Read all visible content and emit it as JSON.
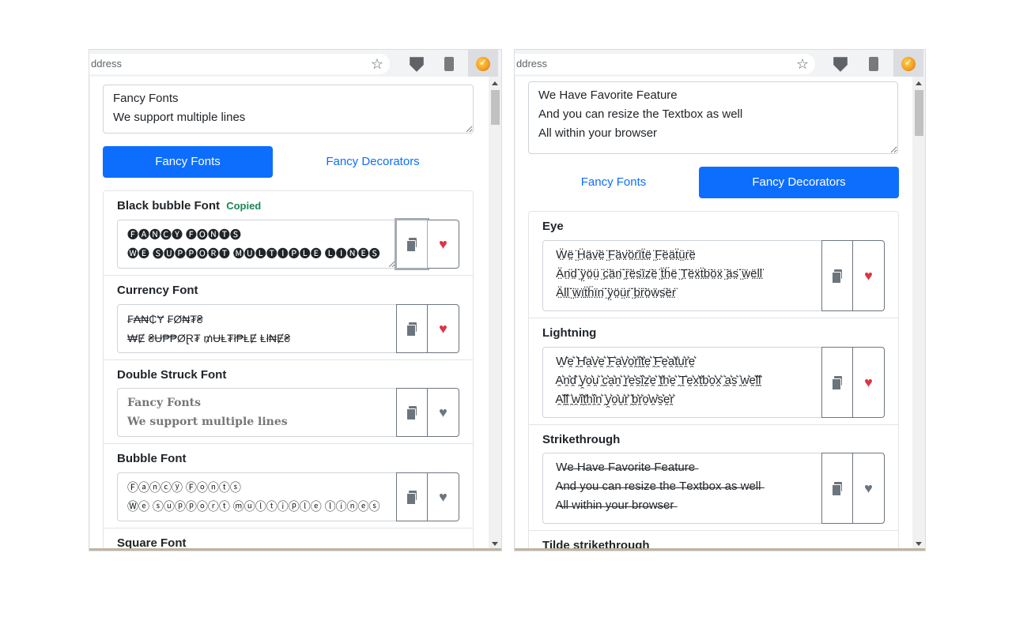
{
  "left": {
    "address_text": "ddress",
    "input_text": "Fancy Fonts\nWe support multiple lines",
    "tabs": [
      {
        "label": "Fancy Fonts",
        "active": true
      },
      {
        "label": "Fancy Decorators",
        "active": false
      }
    ],
    "items": [
      {
        "title": "Black bubble Font",
        "status": "Copied",
        "output": "🅕🅐🅝🅒🅨 🅕🅞🅝🅣🅢\n🅦🅔 🅢🅤🅟🅟🅞🅡🅣 🅜🅤🅛🅣🅘🅟🅛🅔 🅛🅘🅝🅔🅢",
        "favorite": true
      },
      {
        "title": "Currency Font",
        "output": "₣₳₦₵Ɏ ₣Ø₦₮₴\n₩Ɇ ₴Ʉ₱₱ØⱤ₮ ₥ɄⱠ₮ł₱ⱠɆ Ⱡł₦Ɇ₴",
        "favorite": true
      },
      {
        "title": "Double Struck Font",
        "output": "Fancy Fonts\nWe support multiple lines",
        "favorite": false
      },
      {
        "title": "Bubble Font",
        "output": "Ⓕⓐⓝⓒⓨ Ⓕⓞⓝⓣⓢ\nⓌⓔ ⓢⓤⓟⓟⓞⓡⓣ ⓜⓤⓛⓣⓘⓟⓛⓔ ⓛⓘⓝⓔⓢ",
        "favorite": false
      },
      {
        "title": "Square Font"
      }
    ]
  },
  "right": {
    "address_text": "ddress",
    "input_text": "We Have Favorite Feature\nAnd you can resize the Textbox as well\nAll within your browser",
    "tabs": [
      {
        "label": "Fancy Fonts",
        "active": false
      },
      {
        "label": "Fancy Decorators",
        "active": true
      }
    ],
    "items": [
      {
        "title": "Eye",
        "output": " Ẅ̤ë̤ ̤̈Ḧ̤ä̤v̤̈ë̤ ̤̈F̤̈ä̤v̤̈ö̤r̤̈ï̤ẗ̤ë̤ ̤̈F̤̈ë̤ä̤ẗ̤ṳ̈r̤̈ë̤\n Ä̤n̤̈d̤̈ ̤̈ÿ̤ö̤ṳ̈ ̤̈c̤̈ä̤n̤̈ ̤̈r̤̈ë̤s̤̈ï̤z̤̈ë̤ ̤̈ẗ̤ḧ̤ë̤ ̤̈T̤̈ë̤ẍ̤ẗ̤b̤̈ö̤ẍ̤ ̤̈ä̤s̤̈ ̤̈ẅ̤ë̤l̤̈l̤̈\n Ä̤l̤̈l̤̈ ̤̈ẅ̤ï̤ẗ̤ḧ̤ï̤n̤̈ ̤̈ÿ̤ö̤ṳ̈r̤̈ ̤̈b̤̈r̤̈ö̤ẅ̤s̤̈ë̤r̤̈",
        "favorite": true
      },
      {
        "title": "Lightning",
        "output": " W̯͛e̯͛ ̯͛H̯͛a̯͛v̯͛e̯͛ ̯͛F̯͛a̯͛v̯͛o̯͛r̯͛i̯͛t̯͛e̯͛ ̯͛F̯͛e̯͛a̯͛t̯͛u̯͛r̯͛e̯͛\n A̯͛n̯͛d̯͛ ̯͛y̯͛o̯͛u̯͛ ̯͛c̯͛a̯͛n̯͛ ̯͛r̯͛e̯͛s̯͛i̯͛z̯͛e̯͛ ̯͛t̯͛h̯͛e̯͛ ̯͛T̯͛e̯͛x̯͛t̯͛b̯͛o̯͛x̯͛ ̯͛a̯͛s̯͛ ̯͛w̯͛e̯͛l̯͛l̯͛\n A̯͛l̯͛l̯͛ ̯͛w̯͛i̯͛t̯͛h̯͛i̯͛n̯͛ ̯͛y̯͛o̯͛u̯͛r̯͛ ̯͛b̯͛r̯͛o̯͛w̯͛s̯͛e̯͛r̯͛",
        "favorite": true
      },
      {
        "title": "Strikethrough",
        "output": " W̶e̶ ̶H̶a̶v̶e̶ ̶F̶a̶v̶o̶r̶i̶t̶e̶ ̶F̶e̶a̶t̶u̶r̶e̶\n A̶n̶d̶ ̶y̶o̶u̶ ̶c̶a̶n̶ ̶r̶e̶s̶i̶z̶e̶ ̶t̶h̶e̶ ̶T̶e̶x̶t̶b̶o̶x̶ ̶a̶s̶ ̶w̶e̶l̶l̶\n A̶l̶l̶ ̶w̶i̶t̶h̶i̶n̶ ̶y̶o̶u̶r̶ ̶b̶r̶o̶w̶s̶e̶r̶",
        "favorite": false
      },
      {
        "title": "Tilde strikethrough"
      }
    ]
  }
}
